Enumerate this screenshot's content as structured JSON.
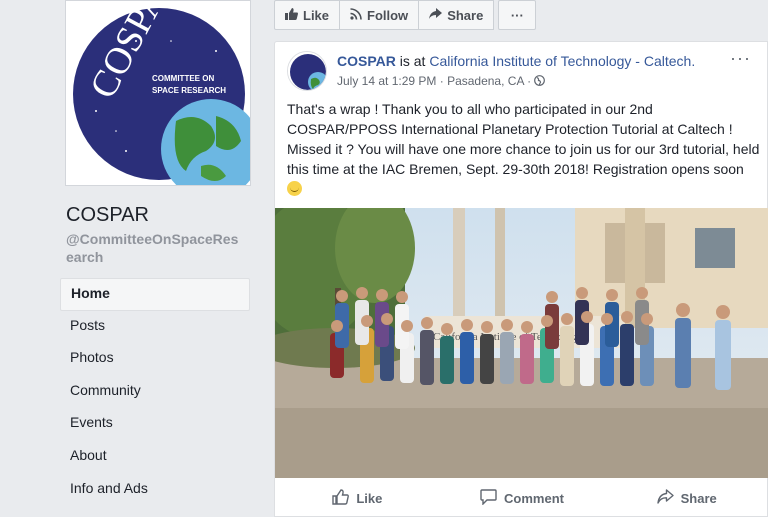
{
  "page": {
    "name": "COSPAR",
    "handle": "@CommitteeOnSpaceResearch",
    "logo": {
      "main": "COSPAR",
      "sub1": "COMMITTEE ON",
      "sub2": "SPACE RESEARCH"
    }
  },
  "nav": [
    {
      "label": "Home",
      "active": true
    },
    {
      "label": "Posts"
    },
    {
      "label": "Photos"
    },
    {
      "label": "Community"
    },
    {
      "label": "Events"
    },
    {
      "label": "About"
    },
    {
      "label": "Info and Ads"
    }
  ],
  "actions": {
    "like": "Like",
    "follow": "Follow",
    "share": "Share",
    "more": "···"
  },
  "post": {
    "author": "COSPAR",
    "is_at": " is at ",
    "location": "California Institute of Technology - Caltech.",
    "date": "July 14 at 1:29 PM",
    "sep": " · ",
    "place": "Pasadena, CA",
    "sep2": " · ",
    "more": "···",
    "text": "That's a wrap ! Thank you to all who participated in our 2nd COSPAR/PPOSS International Planetary Protection Tutorial at Caltech ! Missed it ? You will have one more chance to join us for our 3rd tutorial, held this time at the IAC Bremen, Sept. 29-30th 2018! Registration opens soon ",
    "photo_sign": "California Institute of Technolog"
  },
  "footer": {
    "like": "Like",
    "comment": "Comment",
    "share": "Share"
  },
  "colors": {
    "link": "#365899",
    "logo_blue": "#2b2f7a",
    "bg": "#e9ebee"
  }
}
